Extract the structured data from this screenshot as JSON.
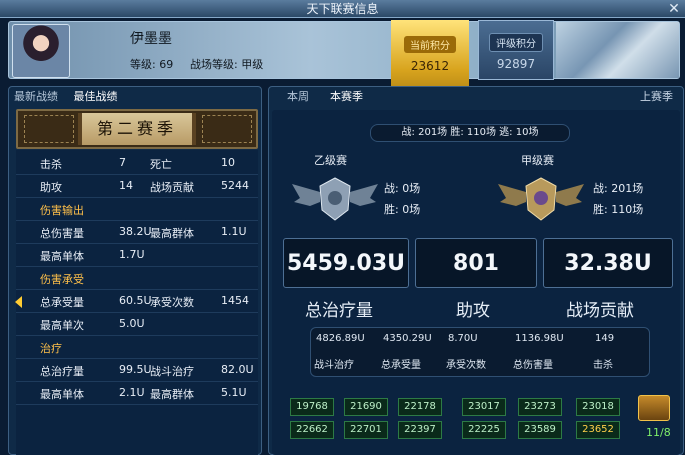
{
  "window": {
    "title": "天下联赛信息"
  },
  "player": {
    "name": "伊墨墨",
    "level": "等级: 69",
    "grade": "战场等级: 甲级"
  },
  "score": {
    "current_label": "当前积分",
    "current_value": "23612",
    "rank_label": "评级积分",
    "rank_value": "92897"
  },
  "left": {
    "tabs": [
      "最新战绩",
      "最佳战绩"
    ],
    "season_banner": "第二赛季",
    "rows": [
      {
        "k1": "击杀",
        "v1": "7",
        "k2": "死亡",
        "v2": "10"
      },
      {
        "k1": "助攻",
        "v1": "14",
        "k2": "战场贡献",
        "v2": "5244"
      },
      {
        "section": "伤害输出"
      },
      {
        "k1": "总伤害量",
        "v1": "38.2U",
        "k2": "最高群体",
        "v2": "1.1U"
      },
      {
        "k1": "最高单体",
        "v1": "1.7U",
        "k2": "",
        "v2": ""
      },
      {
        "section": "伤害承受"
      },
      {
        "k1": "总承受量",
        "v1": "60.5U",
        "k2": "承受次数",
        "v2": "1454"
      },
      {
        "k1": "最高单次",
        "v1": "5.0U",
        "k2": "",
        "v2": ""
      },
      {
        "section": "治疗"
      },
      {
        "k1": "总治疗量",
        "v1": "99.5U",
        "k2": "战斗治疗",
        "v2": "82.0U"
      },
      {
        "k1": "最高单体",
        "v1": "2.1U",
        "k2": "最高群体",
        "v2": "5.1U"
      }
    ]
  },
  "right": {
    "tabs": [
      "本周",
      "本赛季",
      "上赛季"
    ],
    "summary": "战: 201场   胜: 110场   逃: 10场",
    "tier_b": {
      "name": "乙级赛",
      "battles": "战: 0场",
      "wins": "胜: 0场"
    },
    "tier_a": {
      "name": "甲级赛",
      "battles": "战: 201场",
      "wins": "胜: 110场"
    },
    "big": [
      {
        "value": "5459.03U",
        "label": "总治疗量"
      },
      {
        "value": "801",
        "label": "助攻"
      },
      {
        "value": "32.38U",
        "label": "战场贡献"
      }
    ],
    "detail_values": [
      "4826.89U",
      "4350.29U",
      "8.70U",
      "1136.98U",
      "149"
    ],
    "detail_labels": [
      "战斗治疗",
      "总承受量",
      "承受次数",
      "总伤害量",
      "击杀"
    ],
    "ranks_row1": [
      "19768",
      "21690",
      "22178",
      "23017",
      "23273",
      "23018"
    ],
    "ranks_row2": [
      "22662",
      "22701",
      "22397",
      "22225",
      "23589",
      "23652"
    ],
    "chest_count": "11/8"
  },
  "colors": {
    "gold": "#ffc04a",
    "green_rank": "#2d7a45",
    "highlight": "#ffcf4a"
  }
}
